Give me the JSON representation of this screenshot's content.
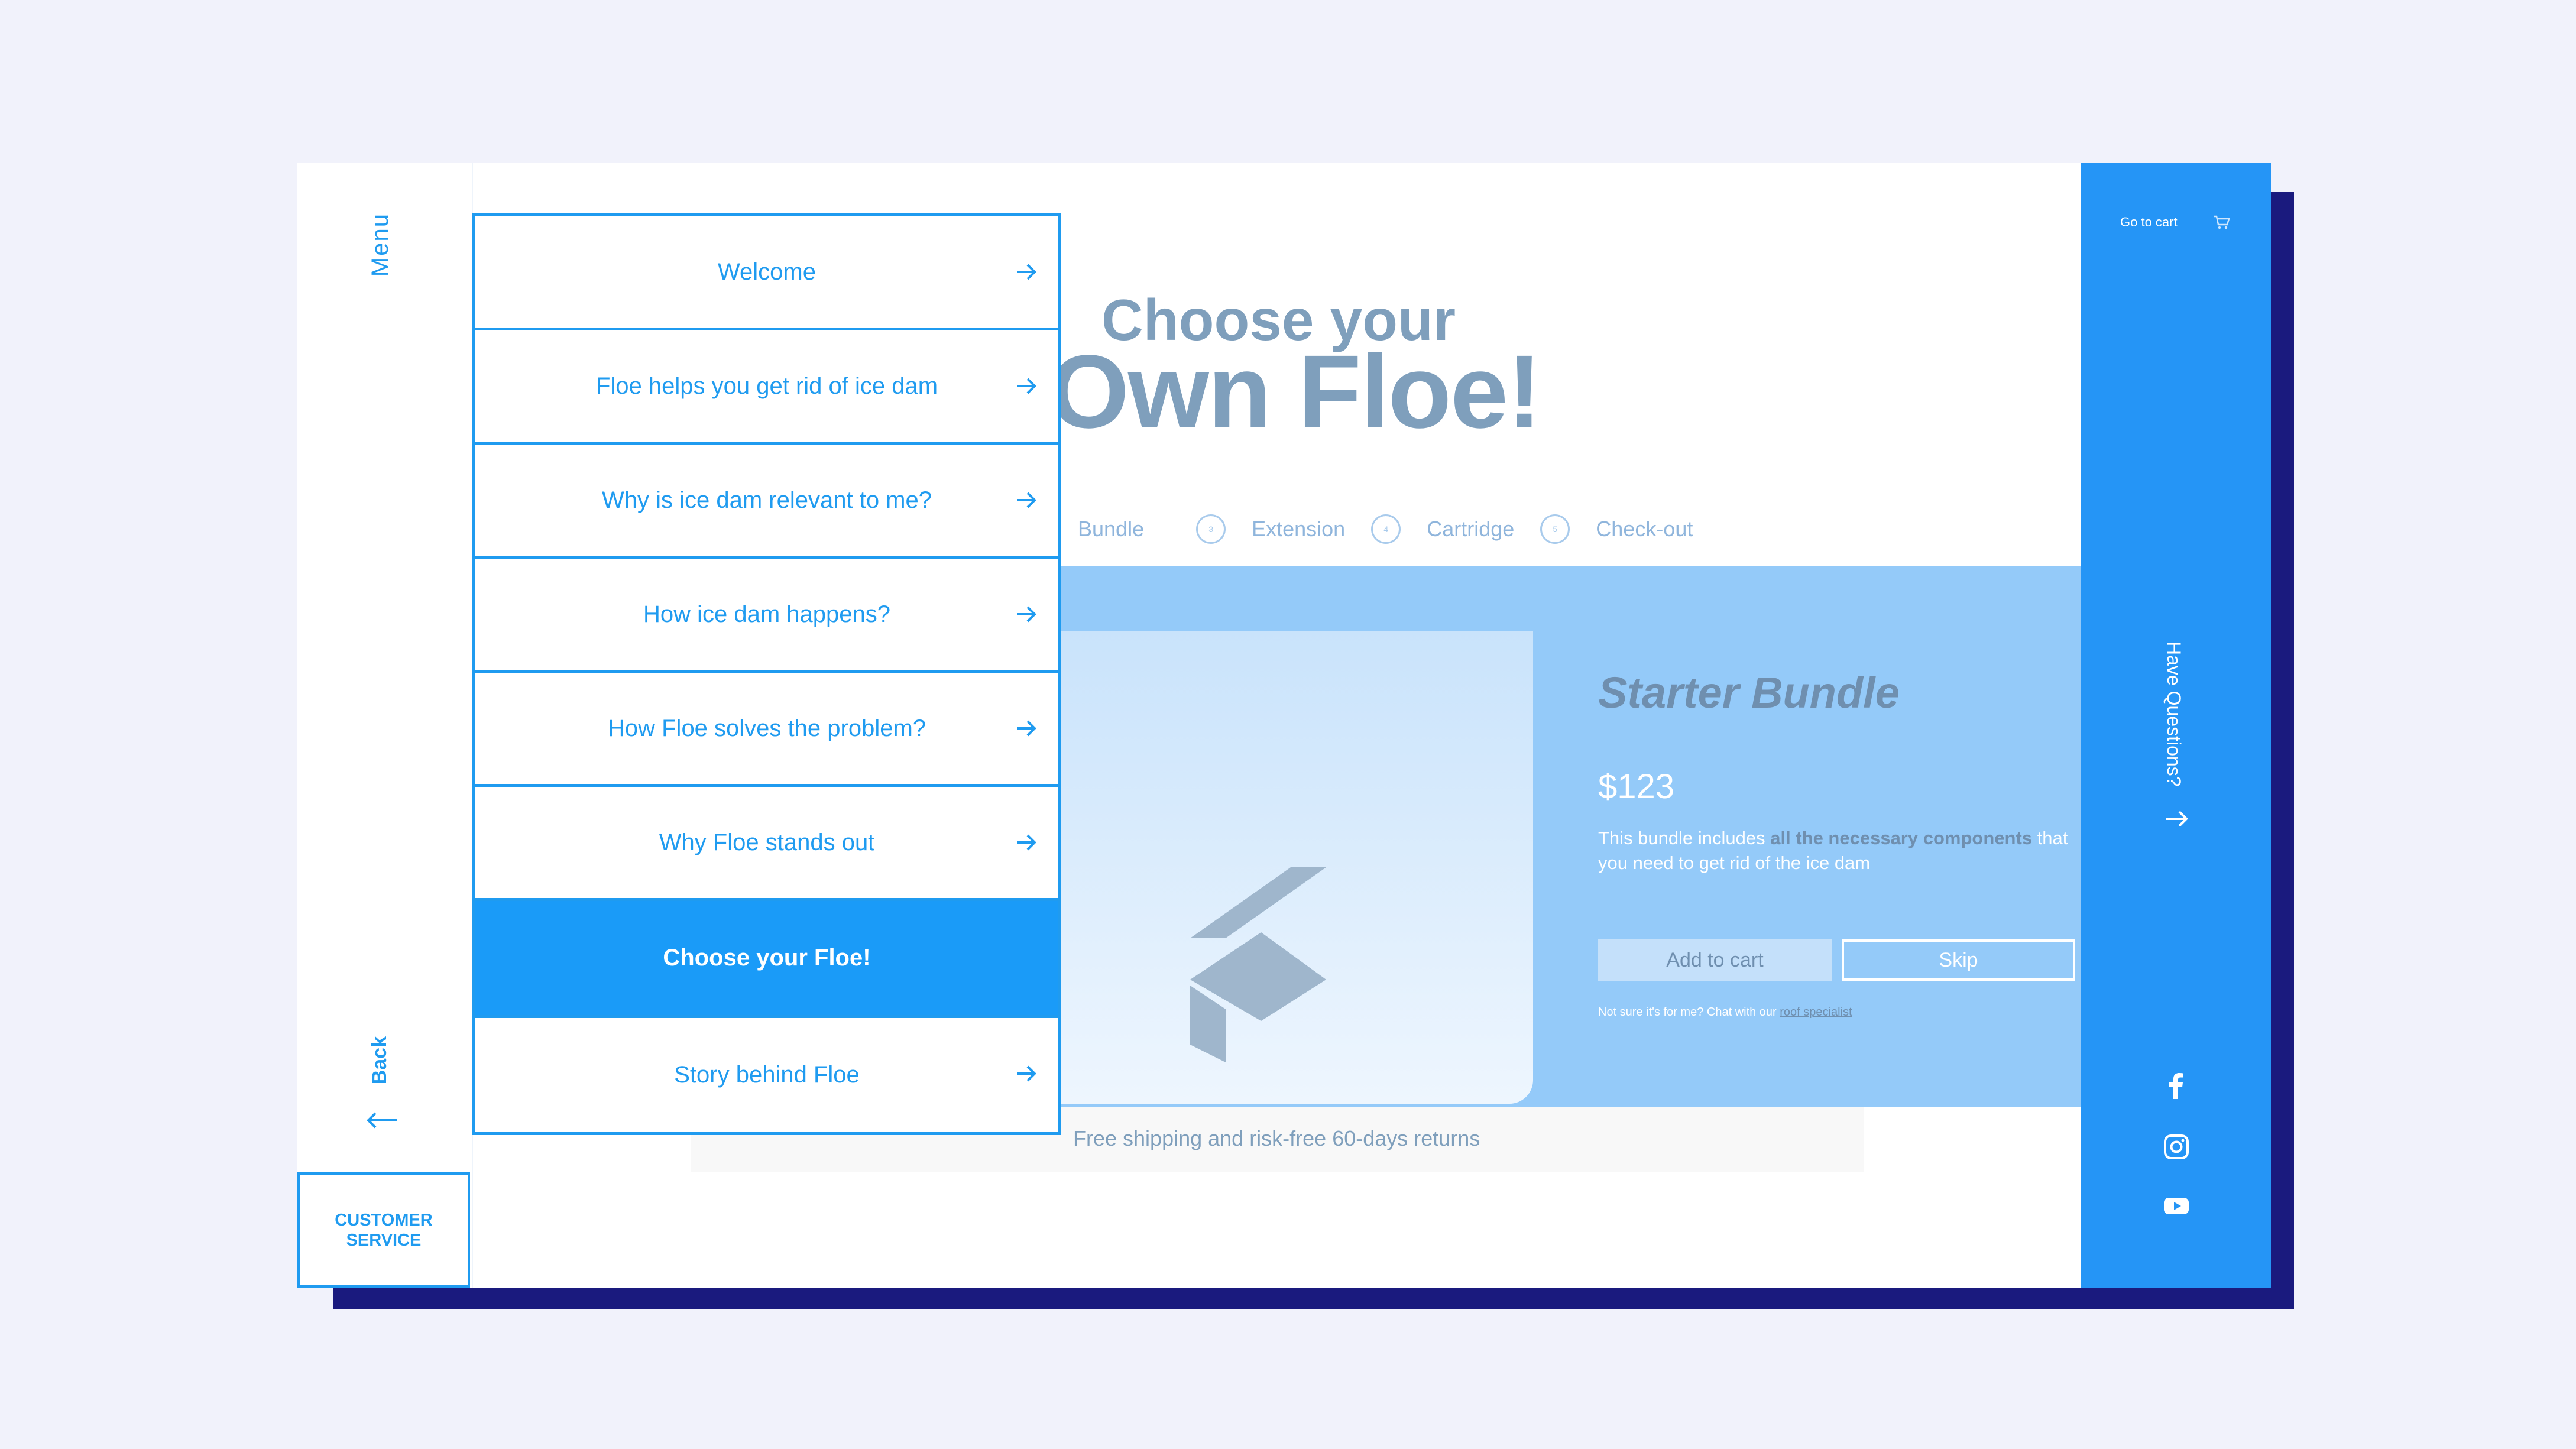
{
  "rail": {
    "menu_label": "Menu",
    "back_label": "Back",
    "customer_service": "CUSTOMER SERVICE"
  },
  "page": {
    "title_line1": "Choose your",
    "title_line2": "Own Floe!",
    "steps": [
      {
        "num": "",
        "label": "Bundle"
      },
      {
        "num": "3",
        "label": "Extension"
      },
      {
        "num": "4",
        "label": "Cartridge"
      },
      {
        "num": "5",
        "label": "Check-out"
      }
    ],
    "bundle": {
      "title": "Starter Bundle",
      "price": "$123",
      "desc_prefix": "This bundle includes ",
      "desc_bold": "all the necessary components",
      "desc_suffix": " that you need to get rid of the ice dam",
      "add_label": "Add to cart",
      "skip_label": "Skip",
      "note_prefix": "Not sure it's for me? Chat with our ",
      "note_link": "roof specialist"
    },
    "shipping": "Free shipping and risk-free 60-days returns"
  },
  "menu": {
    "items": [
      {
        "label": "Welcome"
      },
      {
        "label": "Floe helps you get rid of ice dam"
      },
      {
        "label": "Why is ice dam relevant to me?"
      },
      {
        "label": "How ice dam happens?"
      },
      {
        "label": "How Floe solves the problem?"
      },
      {
        "label": "Why Floe stands out"
      },
      {
        "label": "Choose your Floe!"
      },
      {
        "label": "Story behind Floe"
      }
    ]
  },
  "side": {
    "go_to_cart": "Go to cart",
    "questions": "Have Questions?"
  },
  "colors": {
    "accent": "#1f9bf0",
    "sidebar": "#2595f6",
    "shadow": "#1a1a7e",
    "card": "#94caf9"
  },
  "icons": [
    "arrow-right-icon",
    "arrow-left-icon",
    "cart-icon",
    "facebook-icon",
    "instagram-icon",
    "youtube-icon"
  ]
}
